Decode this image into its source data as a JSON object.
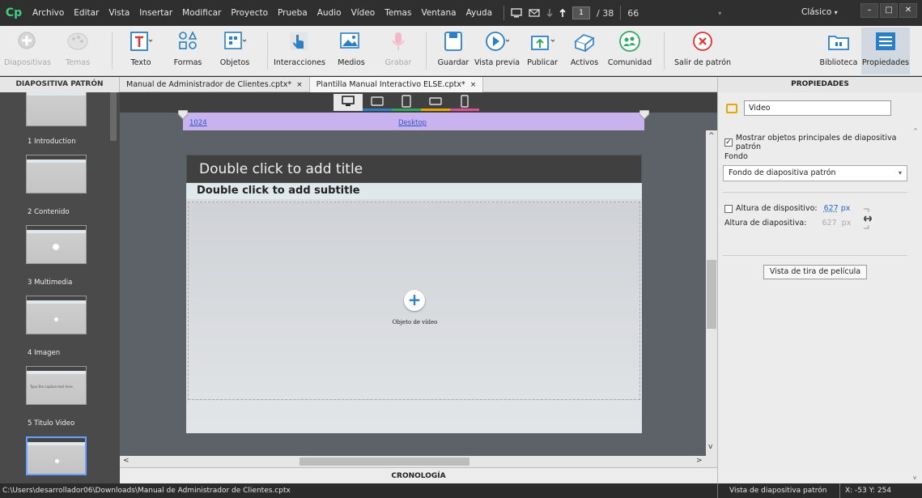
{
  "app": {
    "logo": "Cp",
    "menu": [
      "Archivo",
      "Editar",
      "Vista",
      "Insertar",
      "Modificar",
      "Proyecto",
      "Prueba",
      "Audio",
      "Vídeo",
      "Temas",
      "Ventana",
      "Ayuda"
    ],
    "current_slide": "1",
    "slide_total": "/ 38",
    "zoom": "66",
    "workspace_mode": "Clásico"
  },
  "toolbar": {
    "diapositivas": "Diapositivas",
    "temas": "Temas",
    "texto": "Texto",
    "formas": "Formas",
    "objetos": "Objetos",
    "interacciones": "Interacciones",
    "medios": "Medios",
    "grabar": "Grabar",
    "guardar": "Guardar",
    "vista_previa": "Vista previa",
    "publicar": "Publicar",
    "activos": "Activos",
    "comunidad": "Comunidad",
    "salir_patron": "Salir de patrón",
    "biblioteca": "Biblioteca",
    "propiedades": "Propiedades"
  },
  "left_panel": {
    "header": "DIAPOSITIVA PATRÓN",
    "slides": [
      {
        "label": "1 Introduction"
      },
      {
        "label": "2 Contenido"
      },
      {
        "label": "3 Multimedia"
      },
      {
        "label": "4 Imagen"
      },
      {
        "label": "5 Titulo Video",
        "caption": "Type the caption text here."
      }
    ]
  },
  "tabs": [
    {
      "label": "Manual de Administrador de Clientes.cptx*",
      "close": "×"
    },
    {
      "label": "Plantilla Manual Interactivo ELSE.cptx*",
      "close": "×"
    }
  ],
  "stage": {
    "breakpoint_width": "1024",
    "breakpoint_name": "Desktop",
    "title_placeholder": "Double click to add title",
    "subtitle_placeholder": "Double click to add subtitle",
    "video_label": "Objeto de vídeo",
    "video_plus": "+"
  },
  "timeline": {
    "label": "CRONOLOGÍA"
  },
  "properties": {
    "header": "PROPIEDADES",
    "name_value": "Video",
    "show_master_label": "Mostrar objetos principales de diapositiva patrón",
    "fondo_label": "Fondo",
    "fondo_value": "Fondo de diapositiva patrón",
    "device_height_label": "Altura de dispositivo:",
    "device_height_value": "627",
    "slide_height_label": "Altura de diapositiva:",
    "slide_height_value": "627",
    "px": "px",
    "film_button": "Vista de tira de película"
  },
  "status": {
    "path": "C:\\Users\\desarrollador06\\Downloads\\Manual de Administrador de Clientes.cptx",
    "mode": "Vista de diapositiva patrón",
    "coords": "X: -53 Y: 254"
  },
  "colors": {
    "breakpoint_bar": "#c9b3ef",
    "title_bg": "#404040",
    "subtitle_bg": "#dfe8ea",
    "accent_blue": "#2a7fc5"
  }
}
